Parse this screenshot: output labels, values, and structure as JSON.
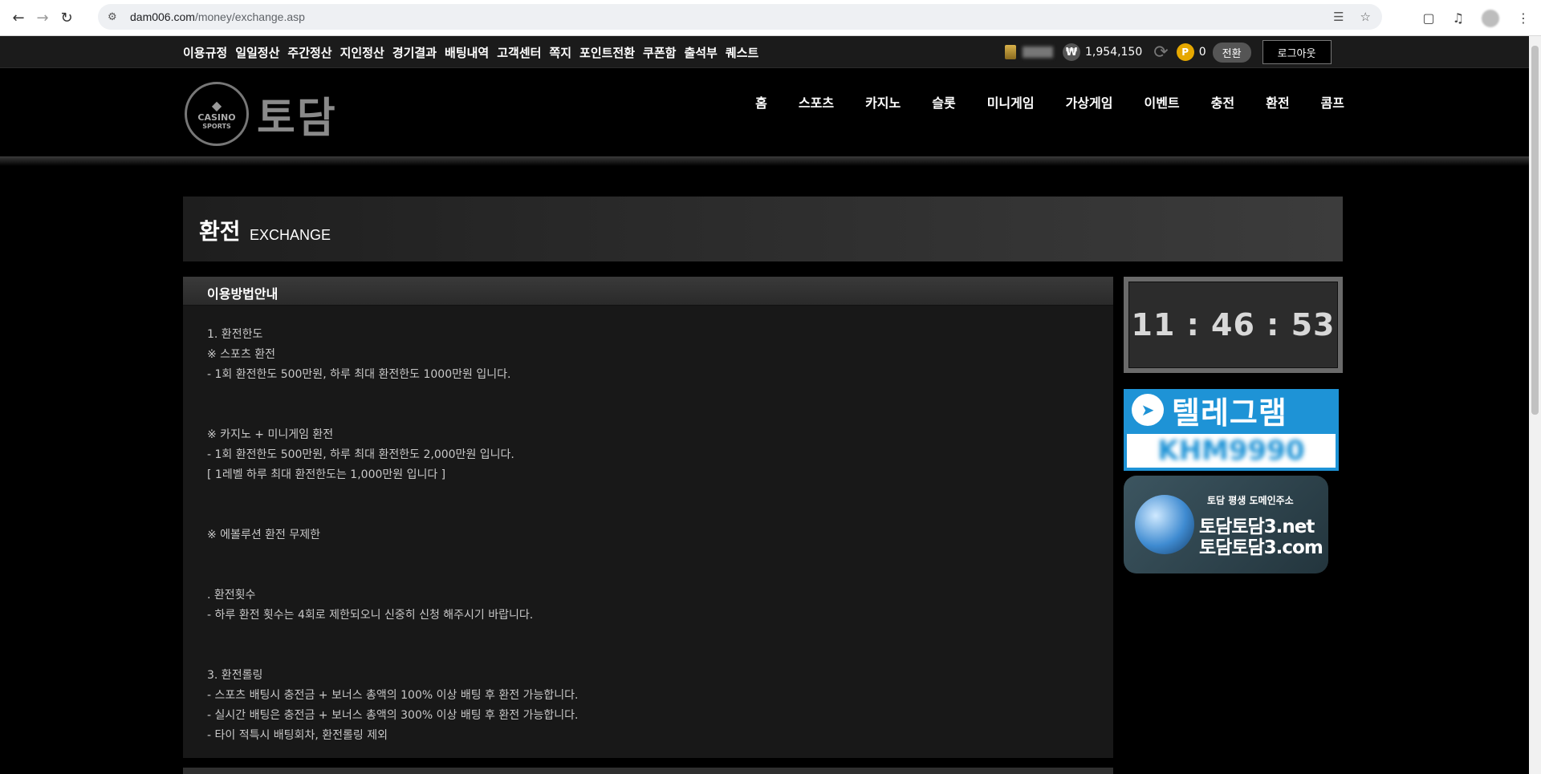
{
  "browser": {
    "url_domain": "dam006.com",
    "url_path": "/money/exchange.asp"
  },
  "topbar": {
    "menu": [
      "이용규정",
      "일일정산",
      "주간정산",
      "지인정산",
      "경기결과",
      "배팅내역",
      "고객센터",
      "쪽지",
      "포인트전환",
      "쿠폰함",
      "출석부",
      "퀘스트"
    ],
    "won_symbol": "₩",
    "money": "1,954,150",
    "point_symbol": "P",
    "points": "0",
    "convert_label": "전환",
    "logout_label": "로그아웃"
  },
  "header": {
    "logo_emblem_line1": "CASINO",
    "logo_emblem_line2": "SPORTS",
    "logo_text": "토담",
    "nav": [
      "홈",
      "스포츠",
      "카지노",
      "슬롯",
      "미니게임",
      "가상게임",
      "이벤트",
      "충전",
      "환전",
      "콤프"
    ]
  },
  "page_title": {
    "ko": "환전",
    "en": "EXCHANGE"
  },
  "guide": {
    "heading": "이용방법안내",
    "lines": [
      "1. 환전한도",
      "※ 스포츠 환전",
      "- 1회 환전한도 500만원, 하루 최대 환전한도 1000만원 입니다.",
      "",
      "",
      "※ 카지노 + 미니게임 환전",
      "- 1회 환전한도 500만원, 하루 최대 환전한도 2,000만원 입니다.",
      "[ 1레벨 하루 최대 환전한도는 1,000만원 입니다 ]",
      "",
      "",
      "※ 에볼루션 환전 무제한",
      "",
      "",
      ". 환전횟수",
      "- 하루 환전 횟수는 4회로 제한되오니 신중히 신청 해주시기 바랍니다.",
      "",
      "",
      "3. 환전롤링",
      "- 스포츠 배팅시 충전금 + 보너스 총액의 100% 이상 배팅 후 환전 가능합니다.",
      "- 실시간 배팅은 충전금 + 보너스 총액의 300% 이상 배팅 후 환전 가능합니다.",
      "- 타이 적특시 배팅회차, 환전롤링 제외"
    ]
  },
  "clock": {
    "time": "11 : 46 : 53"
  },
  "telegram": {
    "title": "텔레그램",
    "id": "KHM9990"
  },
  "domain_banner": {
    "caption": "토담 평생 도메인주소",
    "domain1": "토담토담3.net",
    "domain2": "토담토담3.com"
  }
}
